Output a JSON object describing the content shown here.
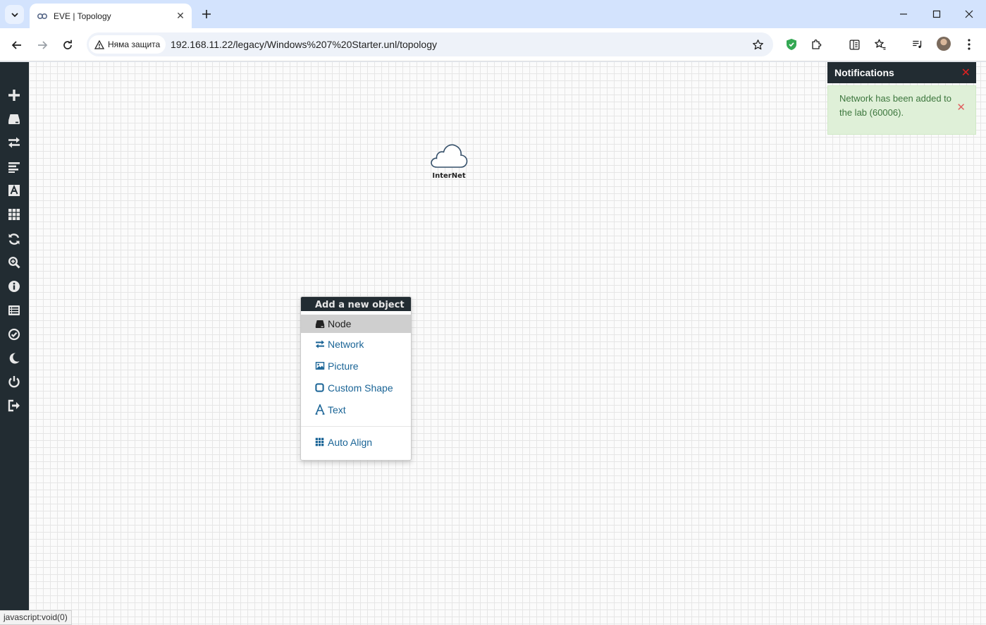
{
  "browser": {
    "tab_title": "EVE | Topology",
    "tab_close": "✕",
    "new_tab": "+",
    "security_label": "Няма защита",
    "url": "192.168.11.22/legacy/Windows%207%20Starter.unl/topology",
    "status_url": "javascript:void(0)"
  },
  "topology": {
    "network_node_label": "InterNet"
  },
  "context_menu": {
    "title": "Add a new object",
    "items": [
      {
        "label": "Node",
        "icon": "node-icon"
      },
      {
        "label": "Network",
        "icon": "network-icon"
      },
      {
        "label": "Picture",
        "icon": "picture-icon"
      },
      {
        "label": "Custom Shape",
        "icon": "custom-shape-icon"
      },
      {
        "label": "Text",
        "icon": "text-icon"
      }
    ],
    "auto_align": "Auto Align"
  },
  "notifications": {
    "title": "Notifications",
    "close": "✕",
    "messages": [
      {
        "text": "Network has been added to the lab (60006).",
        "close": "✕"
      }
    ]
  },
  "colors": {
    "sidebar_bg": "#222c32",
    "menu_link": "#1a6496",
    "notif_success_bg": "#dff0d8",
    "notif_success_text": "#3c763d"
  }
}
